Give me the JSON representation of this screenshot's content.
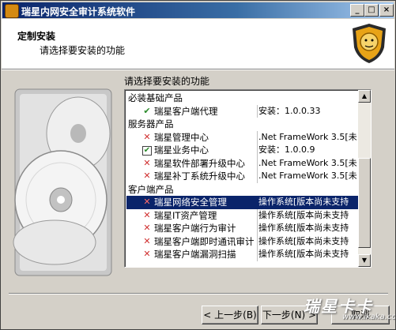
{
  "window": {
    "title": "瑞星内网安全审计系统软件",
    "controls": [
      "_",
      "□",
      "×"
    ]
  },
  "header": {
    "title": "定制安装",
    "subtitle": "请选择要安装的功能"
  },
  "list": {
    "label": "请选择要安装的功能",
    "rows": [
      {
        "type": "group",
        "name": "必装基础产品",
        "status": ""
      },
      {
        "type": "item",
        "icon": "check",
        "name": "瑞星客户端代理",
        "status": "安装：1.0.0.33"
      },
      {
        "type": "group",
        "name": "服务器产品",
        "status": ""
      },
      {
        "type": "item",
        "icon": "x",
        "name": "瑞星管理中心",
        "status": ".Net FrameWork 3.5[未"
      },
      {
        "type": "item",
        "icon": "box-check",
        "name": "瑞星业务中心",
        "status": "安装：1.0.0.9"
      },
      {
        "type": "item",
        "icon": "x",
        "name": "瑞星软件部署升级中心",
        "status": ".Net FrameWork 3.5[未"
      },
      {
        "type": "item",
        "icon": "x",
        "name": "瑞星补丁系统升级中心",
        "status": ".Net FrameWork 3.5[未"
      },
      {
        "type": "group",
        "name": "客户端产品",
        "status": ""
      },
      {
        "type": "item",
        "icon": "x",
        "name": "瑞星网络安全管理",
        "status": "操作系统[版本尚未支持",
        "selected": true
      },
      {
        "type": "item",
        "icon": "x",
        "name": "瑞星IT资产管理",
        "status": "操作系统[版本尚未支持"
      },
      {
        "type": "item",
        "icon": "x",
        "name": "瑞星客户端行为审计",
        "status": "操作系统[版本尚未支持"
      },
      {
        "type": "item",
        "icon": "x",
        "name": "瑞星客户端即时通讯审计",
        "status": "操作系统[版本尚未支持"
      },
      {
        "type": "item",
        "icon": "x",
        "name": "瑞星客户端漏洞扫描",
        "status": "操作系统[版本尚未支持"
      }
    ]
  },
  "buttons": {
    "back": "< 上一步(B)",
    "next": "下一步(N) >",
    "cancel": "取消"
  },
  "watermark": {
    "brand": "瑞星卡卡",
    "site": "www.ikaka.com"
  }
}
